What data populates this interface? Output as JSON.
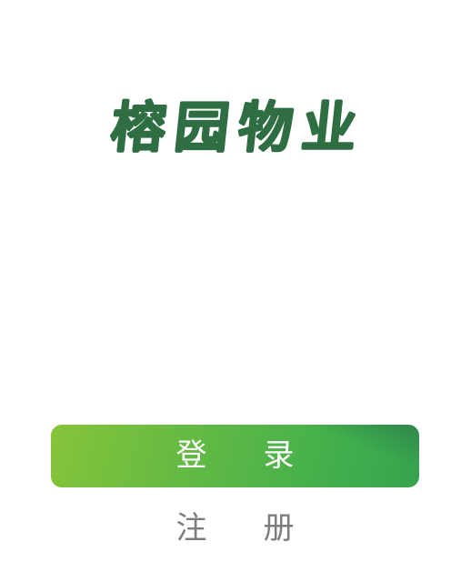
{
  "brand": {
    "logo_text": "榕园物业",
    "color": "#2f6e43"
  },
  "auth": {
    "login_label": "登录",
    "register_label": "注册",
    "login_gradient": [
      "#86c43a",
      "#3fae4d"
    ],
    "register_color": "#7d7d7d"
  }
}
